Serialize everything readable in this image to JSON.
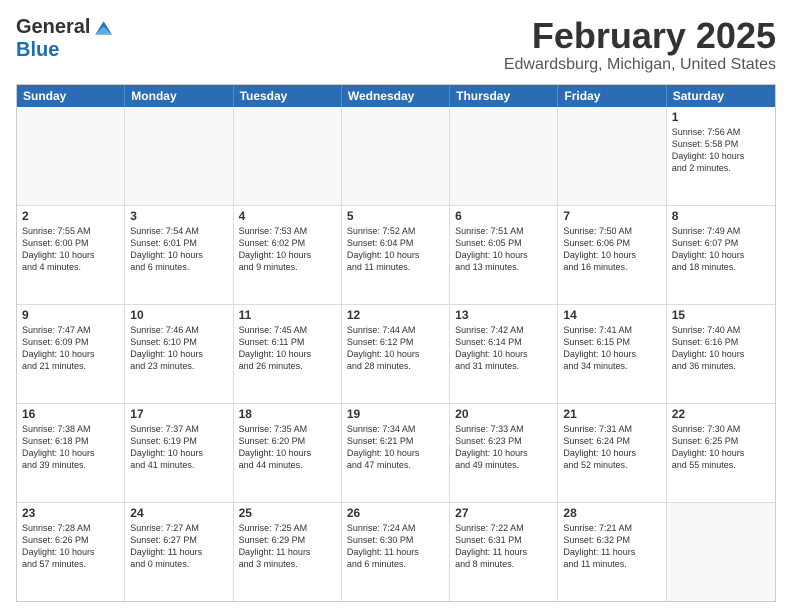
{
  "header": {
    "logo": {
      "general": "General",
      "blue": "Blue"
    },
    "title": "February 2025",
    "location": "Edwardsburg, Michigan, United States"
  },
  "days_of_week": [
    "Sunday",
    "Monday",
    "Tuesday",
    "Wednesday",
    "Thursday",
    "Friday",
    "Saturday"
  ],
  "weeks": [
    [
      {
        "day": "",
        "info": ""
      },
      {
        "day": "",
        "info": ""
      },
      {
        "day": "",
        "info": ""
      },
      {
        "day": "",
        "info": ""
      },
      {
        "day": "",
        "info": ""
      },
      {
        "day": "",
        "info": ""
      },
      {
        "day": "1",
        "info": "Sunrise: 7:56 AM\nSunset: 5:58 PM\nDaylight: 10 hours\nand 2 minutes."
      }
    ],
    [
      {
        "day": "2",
        "info": "Sunrise: 7:55 AM\nSunset: 6:00 PM\nDaylight: 10 hours\nand 4 minutes."
      },
      {
        "day": "3",
        "info": "Sunrise: 7:54 AM\nSunset: 6:01 PM\nDaylight: 10 hours\nand 6 minutes."
      },
      {
        "day": "4",
        "info": "Sunrise: 7:53 AM\nSunset: 6:02 PM\nDaylight: 10 hours\nand 9 minutes."
      },
      {
        "day": "5",
        "info": "Sunrise: 7:52 AM\nSunset: 6:04 PM\nDaylight: 10 hours\nand 11 minutes."
      },
      {
        "day": "6",
        "info": "Sunrise: 7:51 AM\nSunset: 6:05 PM\nDaylight: 10 hours\nand 13 minutes."
      },
      {
        "day": "7",
        "info": "Sunrise: 7:50 AM\nSunset: 6:06 PM\nDaylight: 10 hours\nand 16 minutes."
      },
      {
        "day": "8",
        "info": "Sunrise: 7:49 AM\nSunset: 6:07 PM\nDaylight: 10 hours\nand 18 minutes."
      }
    ],
    [
      {
        "day": "9",
        "info": "Sunrise: 7:47 AM\nSunset: 6:09 PM\nDaylight: 10 hours\nand 21 minutes."
      },
      {
        "day": "10",
        "info": "Sunrise: 7:46 AM\nSunset: 6:10 PM\nDaylight: 10 hours\nand 23 minutes."
      },
      {
        "day": "11",
        "info": "Sunrise: 7:45 AM\nSunset: 6:11 PM\nDaylight: 10 hours\nand 26 minutes."
      },
      {
        "day": "12",
        "info": "Sunrise: 7:44 AM\nSunset: 6:12 PM\nDaylight: 10 hours\nand 28 minutes."
      },
      {
        "day": "13",
        "info": "Sunrise: 7:42 AM\nSunset: 6:14 PM\nDaylight: 10 hours\nand 31 minutes."
      },
      {
        "day": "14",
        "info": "Sunrise: 7:41 AM\nSunset: 6:15 PM\nDaylight: 10 hours\nand 34 minutes."
      },
      {
        "day": "15",
        "info": "Sunrise: 7:40 AM\nSunset: 6:16 PM\nDaylight: 10 hours\nand 36 minutes."
      }
    ],
    [
      {
        "day": "16",
        "info": "Sunrise: 7:38 AM\nSunset: 6:18 PM\nDaylight: 10 hours\nand 39 minutes."
      },
      {
        "day": "17",
        "info": "Sunrise: 7:37 AM\nSunset: 6:19 PM\nDaylight: 10 hours\nand 41 minutes."
      },
      {
        "day": "18",
        "info": "Sunrise: 7:35 AM\nSunset: 6:20 PM\nDaylight: 10 hours\nand 44 minutes."
      },
      {
        "day": "19",
        "info": "Sunrise: 7:34 AM\nSunset: 6:21 PM\nDaylight: 10 hours\nand 47 minutes."
      },
      {
        "day": "20",
        "info": "Sunrise: 7:33 AM\nSunset: 6:23 PM\nDaylight: 10 hours\nand 49 minutes."
      },
      {
        "day": "21",
        "info": "Sunrise: 7:31 AM\nSunset: 6:24 PM\nDaylight: 10 hours\nand 52 minutes."
      },
      {
        "day": "22",
        "info": "Sunrise: 7:30 AM\nSunset: 6:25 PM\nDaylight: 10 hours\nand 55 minutes."
      }
    ],
    [
      {
        "day": "23",
        "info": "Sunrise: 7:28 AM\nSunset: 6:26 PM\nDaylight: 10 hours\nand 57 minutes."
      },
      {
        "day": "24",
        "info": "Sunrise: 7:27 AM\nSunset: 6:27 PM\nDaylight: 11 hours\nand 0 minutes."
      },
      {
        "day": "25",
        "info": "Sunrise: 7:25 AM\nSunset: 6:29 PM\nDaylight: 11 hours\nand 3 minutes."
      },
      {
        "day": "26",
        "info": "Sunrise: 7:24 AM\nSunset: 6:30 PM\nDaylight: 11 hours\nand 6 minutes."
      },
      {
        "day": "27",
        "info": "Sunrise: 7:22 AM\nSunset: 6:31 PM\nDaylight: 11 hours\nand 8 minutes."
      },
      {
        "day": "28",
        "info": "Sunrise: 7:21 AM\nSunset: 6:32 PM\nDaylight: 11 hours\nand 11 minutes."
      },
      {
        "day": "",
        "info": ""
      }
    ]
  ]
}
